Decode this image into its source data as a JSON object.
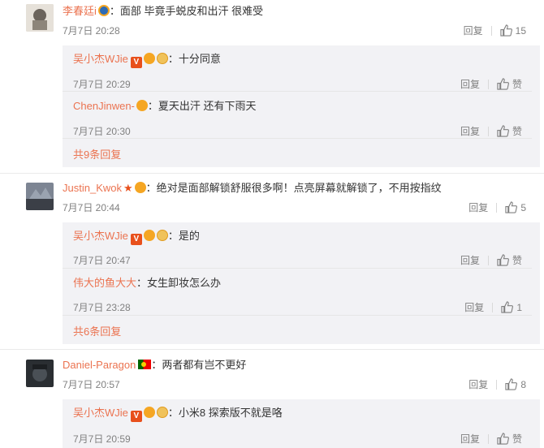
{
  "comments": [
    {
      "user": "李春廷i",
      "text": "：面部  毕竟手蜕皮和出汗 很难受",
      "time": "7月7日 20:28",
      "reply_label": "回复",
      "likes": "15",
      "avatar_color": "#c8c0b8",
      "replies": [
        {
          "user": "吴小杰WJie",
          "text": "：十分同意",
          "time": "7月7日 20:29",
          "reply_label": "回复",
          "like_label": "赞"
        },
        {
          "user": "ChenJinwen-",
          "text": "：夏天出汗 还有下雨天",
          "time": "7月7日 20:30",
          "reply_label": "回复",
          "like_label": "赞"
        }
      ],
      "more": "共9条回复"
    },
    {
      "user": "Justin_Kwok",
      "text": "：绝对是面部解锁舒服很多啊！点亮屏幕就解锁了，不用按指纹",
      "time": "7月7日 20:44",
      "reply_label": "回复",
      "likes": "5",
      "avatar_color": "#5a5f6a",
      "replies": [
        {
          "user": "吴小杰WJie",
          "text": "：是的",
          "time": "7月7日 20:47",
          "reply_label": "回复",
          "like_label": "赞"
        },
        {
          "user": "伟大的鱼大大",
          "text": "：女生卸妆怎么办",
          "time": "7月7日 23:28",
          "reply_label": "回复",
          "like_label": "1"
        }
      ],
      "more": "共6条回复"
    },
    {
      "user": "Daniel-Paragon",
      "text": "：两者都有岂不更好",
      "time": "7月7日 20:57",
      "reply_label": "回复",
      "likes": "8",
      "avatar_color": "#2f3438",
      "replies": [
        {
          "user": "吴小杰WJie",
          "text": "：小米8 探索版不就是咯",
          "time": "7月7日 20:59",
          "reply_label": "回复",
          "like_label": "赞"
        }
      ]
    }
  ],
  "colors": {
    "accent": "#eb7350",
    "muted": "#808080",
    "reply_bg": "#f2f2f5"
  }
}
